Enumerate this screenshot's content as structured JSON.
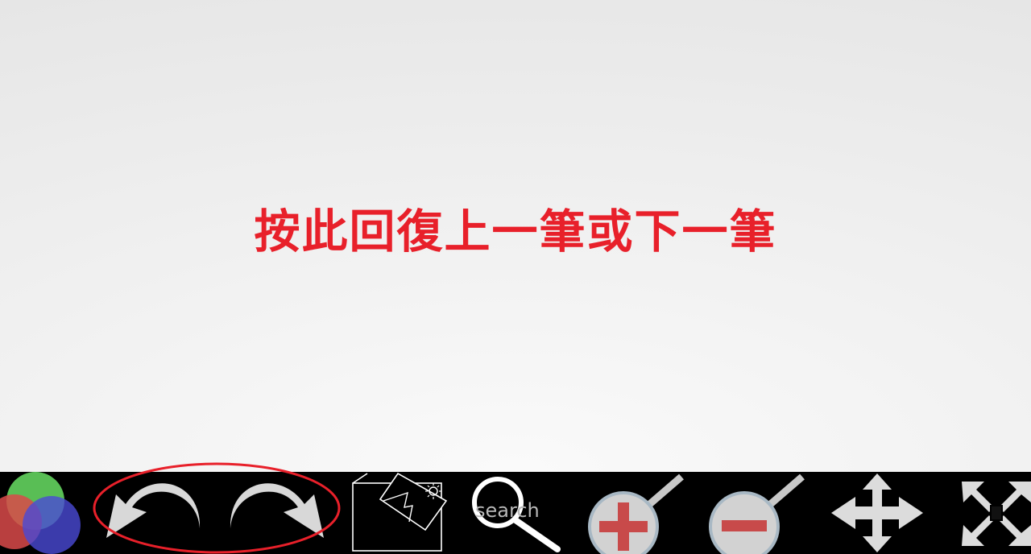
{
  "instruction": {
    "text": "按此回復上一筆或下一筆",
    "color": "#e8202a"
  },
  "toolbar": {
    "background": "#000000",
    "tools": [
      {
        "name": "color-picker",
        "icon": "overlapping-circles-icon"
      },
      {
        "name": "undo",
        "icon": "undo-arrow-icon"
      },
      {
        "name": "redo",
        "icon": "redo-arrow-icon"
      },
      {
        "name": "background-image",
        "icon": "image-frame-icon"
      },
      {
        "name": "search",
        "icon": "magnifier-icon",
        "label": "search"
      },
      {
        "name": "zoom-in",
        "icon": "zoom-in-icon"
      },
      {
        "name": "zoom-out",
        "icon": "zoom-out-icon"
      },
      {
        "name": "pan",
        "icon": "move-arrows-icon"
      },
      {
        "name": "fullscreen",
        "icon": "expand-arrows-icon"
      }
    ]
  },
  "highlight": {
    "color": "#e8202a",
    "target": "undo-redo"
  }
}
